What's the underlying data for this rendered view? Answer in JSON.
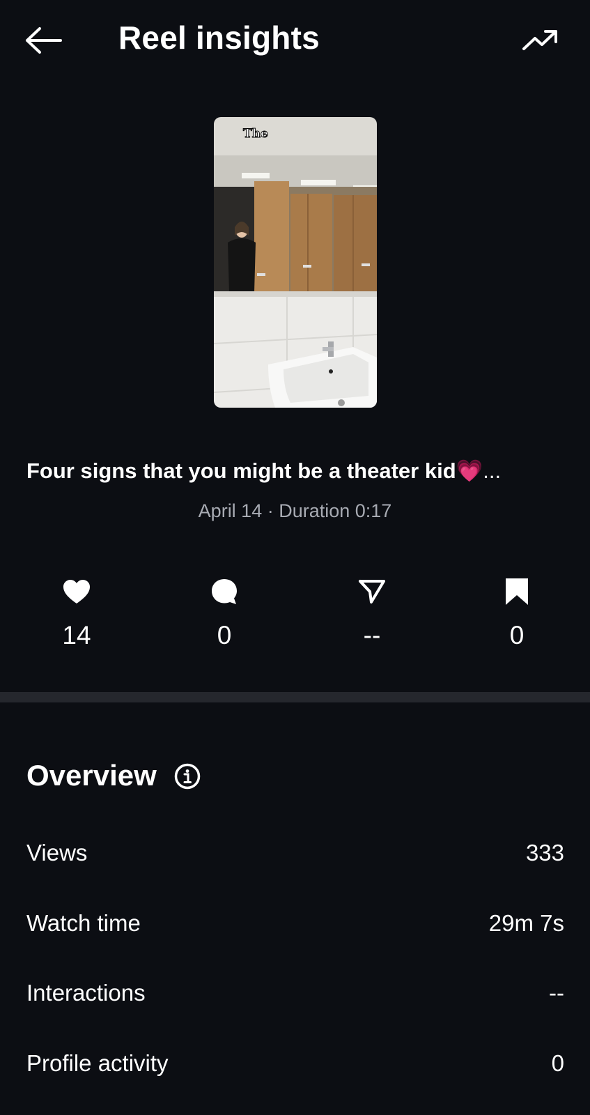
{
  "header": {
    "title": "Reel insights",
    "back_icon": "arrow-left-icon",
    "trend_icon": "trending-up-icon"
  },
  "reel": {
    "thumbnail_overlay_text": "The",
    "caption": "Four signs that you might be a theater kid",
    "caption_emoji": "💗",
    "caption_ellipsis": "...",
    "meta": "April 14 · Duration 0:17"
  },
  "stats": [
    {
      "icon": "heart-icon",
      "value": "14"
    },
    {
      "icon": "comment-icon",
      "value": "0"
    },
    {
      "icon": "share-icon",
      "value": "--"
    },
    {
      "icon": "bookmark-icon",
      "value": "0"
    }
  ],
  "overview": {
    "title": "Overview",
    "info_icon": "info-icon",
    "rows": [
      {
        "label": "Views",
        "value": "333"
      },
      {
        "label": "Watch time",
        "value": "29m 7s"
      },
      {
        "label": "Interactions",
        "value": "--"
      },
      {
        "label": "Profile activity",
        "value": "0"
      }
    ]
  },
  "colors": {
    "background": "#0c0e13",
    "divider": "#25272d",
    "meta_text": "#a8abb3",
    "heart_emoji": "#e6427e"
  }
}
